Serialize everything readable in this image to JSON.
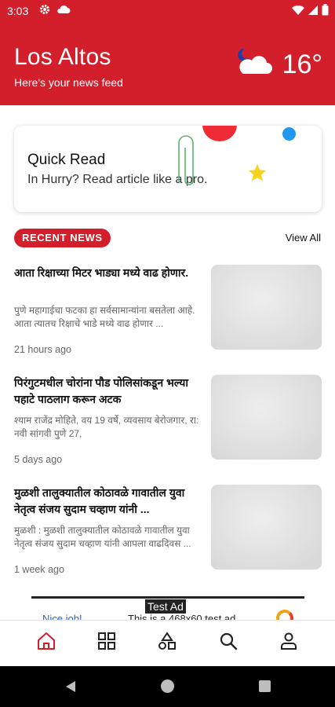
{
  "status_bar": {
    "time": "3:03",
    "icons": [
      "gear-icon",
      "cloud-icon",
      "wifi-icon",
      "signal-icon",
      "battery-icon"
    ]
  },
  "header": {
    "city": "Los Altos",
    "tagline": "Here's your news feed",
    "weather_icon": "moon-cloud-icon",
    "temperature": "16°"
  },
  "quick_read": {
    "title": "Quick Read",
    "subtitle": "In Hurry? Read article like a pro."
  },
  "recent_news": {
    "badge": "RECENT NEWS",
    "view_all": "View All",
    "items": [
      {
        "title": "आता रिक्षाच्या मिटर भाड्या मध्ये वाढ होणार.",
        "summary": "पुणे महागाईचा फटका हा सर्वसामान्यांना बसतेला आहे. आता त्यातच रिक्षाचे भाडे मध्ये वाढ होणार ...",
        "time": "21 hours ago"
      },
      {
        "title": "पिरंगुटमधील चोरांना पौड पोलिसांकडून भल्या पहाटे पाठलाग करून अटक",
        "summary": "श्याम राजेंद्र मोहिते, वय 19 वर्षे, व्यवसाय बेरोजगार, रा: नवी सांगवी पुणे 27,",
        "time": "5 days ago"
      },
      {
        "title": "मुळशी तालुक्यातील कोठावळे गावातील युवा नेतृत्व संजय सुदाम चव्हाण यांनी ...",
        "summary": "मुळशी : मुळशी तालुक्यातील कोठावळे गावातील युवा नेतृत्व संजय सुदाम चव्हाण यांनी आपला वाढदिवस ...",
        "time": "1 week ago"
      }
    ]
  },
  "ad": {
    "label": "Test Ad",
    "left_text": "Nice job!",
    "right_text": "This is a 468x60 test ad."
  },
  "bottom_nav": [
    "home-icon",
    "grid-icon",
    "shapes-icon",
    "search-icon",
    "profile-icon"
  ],
  "colors": {
    "brand": "#d31f2c",
    "accent_yellow": "#f7d31e",
    "accent_blue": "#2196f3"
  }
}
